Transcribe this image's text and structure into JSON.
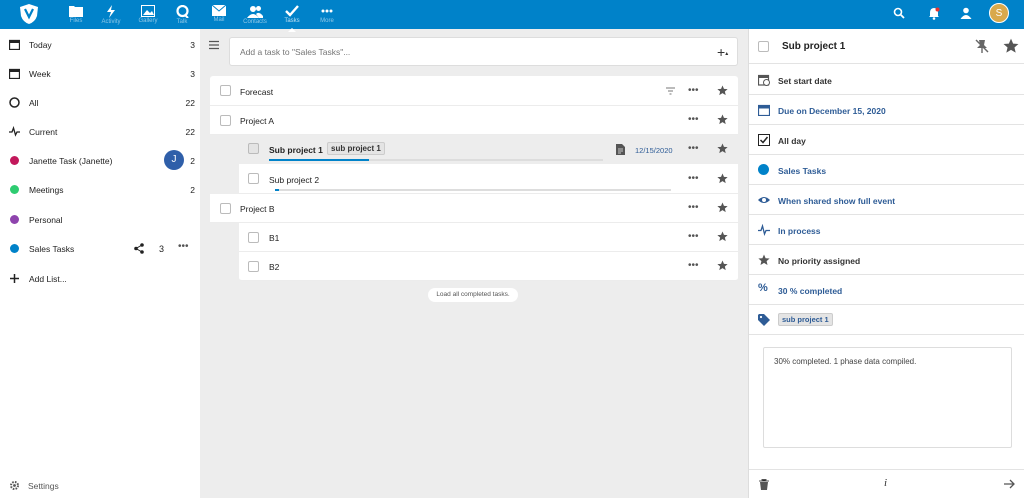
{
  "topbar": {
    "apps": [
      {
        "name": "Files",
        "label": "Files"
      },
      {
        "name": "Activity",
        "label": "Activity"
      },
      {
        "name": "Photos",
        "label": "Gallery"
      },
      {
        "name": "Talk",
        "label": "Talk"
      },
      {
        "name": "Mail",
        "label": "Mail"
      },
      {
        "name": "Contacts",
        "label": "Contacts"
      },
      {
        "name": "Tasks",
        "label": "Tasks"
      },
      {
        "name": "More",
        "label": "More"
      }
    ],
    "user_initial": "S",
    "accent": "#0082c9"
  },
  "sidebar": {
    "items": [
      {
        "label": "Today",
        "count": "3"
      },
      {
        "label": "Week",
        "count": "3"
      },
      {
        "label": "All",
        "count": "22"
      },
      {
        "label": "Current",
        "count": "22"
      },
      {
        "label": "Janette Task (Janette)",
        "count": "2",
        "bubble": "J",
        "color": "#c2185b"
      },
      {
        "label": "Meetings",
        "count": "2",
        "color": "#2ecc71"
      },
      {
        "label": "Personal",
        "count": "",
        "color": "#8e44ad"
      },
      {
        "label": "Sales Tasks",
        "count": "3",
        "color": "#0082c9"
      }
    ],
    "add_list": "Add List...",
    "settings": "Settings"
  },
  "main": {
    "add_placeholder": "Add a task to \"Sales Tasks\"...",
    "tasks": [
      {
        "title": "Forecast"
      },
      {
        "title": "Project A"
      },
      {
        "title": "Sub project 1",
        "tag": "sub project 1",
        "due": "12/15/2020",
        "progress": 0.3
      },
      {
        "title": "Sub project 2",
        "progress": 0.01
      },
      {
        "title": "Project B"
      },
      {
        "title": "B1"
      },
      {
        "title": "B2"
      }
    ],
    "load_completed": "Load all completed tasks."
  },
  "detail": {
    "title": "Sub project 1",
    "rows": [
      {
        "label": "Set start date"
      },
      {
        "label": "Due on December 15, 2020"
      },
      {
        "label": "All day"
      },
      {
        "label": "Sales Tasks"
      },
      {
        "label": "When shared show full event"
      },
      {
        "label": "In process"
      },
      {
        "label": "No priority assigned"
      },
      {
        "label": "30 % completed"
      },
      {
        "label": "sub project 1"
      }
    ],
    "notes": "30% completed. 1 phase data compiled."
  }
}
